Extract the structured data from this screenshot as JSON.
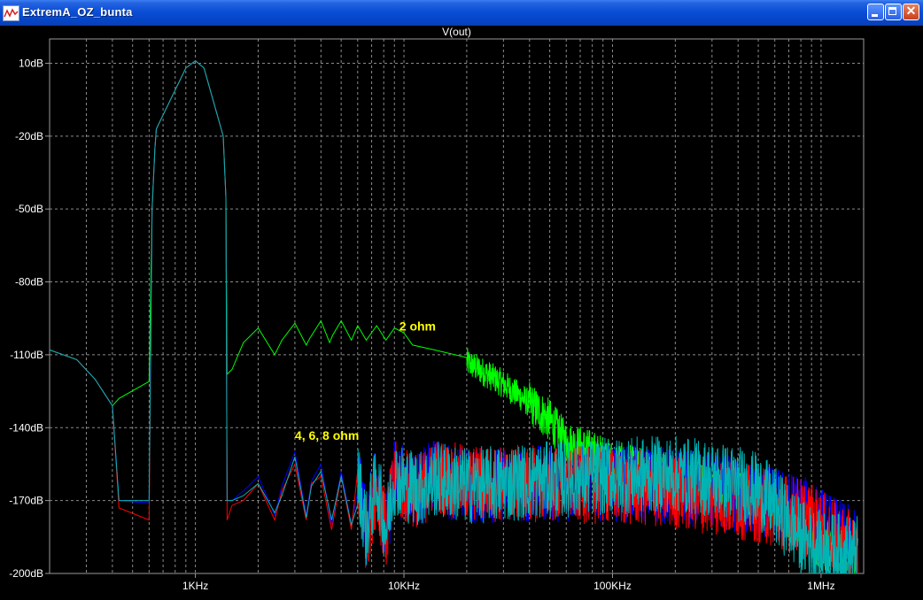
{
  "window": {
    "title": "ExtremA_OZ_bunta",
    "icon": "ltspice-waveform-icon",
    "buttons": [
      "minimize-icon",
      "maximize-icon",
      "close-icon"
    ]
  },
  "chart_data": {
    "type": "line",
    "title": "V(out)",
    "xscale": "log",
    "xlim": [
      200,
      1600000
    ],
    "ylim": [
      -200,
      20
    ],
    "grid": true,
    "x_ticks": [
      {
        "value": 1000,
        "label": "1KHz"
      },
      {
        "value": 10000,
        "label": "10KHz"
      },
      {
        "value": 100000,
        "label": "100KHz"
      },
      {
        "value": 1000000,
        "label": "1MHz"
      }
    ],
    "y_ticks": [
      {
        "value": 10,
        "label": "10dB"
      },
      {
        "value": -20,
        "label": "-20dB"
      },
      {
        "value": -50,
        "label": "-50dB"
      },
      {
        "value": -80,
        "label": "-80dB"
      },
      {
        "value": -110,
        "label": "-110dB"
      },
      {
        "value": -140,
        "label": "-140dB"
      },
      {
        "value": -170,
        "label": "-170dB"
      },
      {
        "value": -200,
        "label": "-200dB"
      }
    ],
    "annotations": [
      {
        "text": "2 ohm",
        "x": 9500,
        "y": -100,
        "color": "#ffff00"
      },
      {
        "text": "4, 6, 8 ohm",
        "x": 3000,
        "y": -145,
        "color": "#ffff00"
      }
    ],
    "series": [
      {
        "color": "#00ff00",
        "x": [
          200,
          270,
          330,
          400,
          430,
          600,
          620,
          640,
          650,
          900,
          1000,
          1100,
          1360,
          1400,
          1420,
          1500,
          1700,
          2000,
          2400,
          2600,
          3000,
          3400,
          3550,
          4000,
          4400,
          4550,
          5000,
          5600,
          6000,
          6600,
          7400,
          8200,
          9000,
          10000,
          11000,
          14000,
          20000,
          30000,
          40000,
          50000,
          60000,
          80000,
          100000,
          150000,
          200000,
          300000,
          400000,
          500000,
          600000,
          800000,
          1000000,
          1500000
        ],
        "y": [
          -108,
          -112,
          -120,
          -131,
          -128,
          -121,
          -50,
          -25,
          -17,
          8,
          11,
          8,
          -20,
          -45,
          -118,
          -116,
          -105,
          -99,
          -110,
          -104,
          -97,
          -106,
          -103,
          -96,
          -105,
          -102,
          -96,
          -104,
          -98,
          -104,
          -98,
          -104,
          -99,
          -101,
          -106,
          -108,
          -113,
          -122,
          -130,
          -137,
          -146,
          -150,
          -154,
          -158,
          -161,
          -164,
          -166,
          -167,
          -174,
          -180,
          -190,
          -194
        ],
        "noise_from": 20000
      },
      {
        "color": "#0000ff",
        "x": [
          200,
          270,
          330,
          400,
          430,
          600,
          620,
          640,
          650,
          900,
          1000,
          1100,
          1360,
          1400,
          1420,
          1500,
          1700,
          2000,
          2400,
          2600,
          3000,
          3400,
          3600,
          4000,
          4500,
          5000,
          5600,
          6000,
          6600,
          7400,
          8200,
          9000,
          10000,
          12000,
          14000,
          20000,
          40000,
          100000,
          200000,
          400000,
          800000,
          1500000
        ],
        "y": [
          -108,
          -112,
          -120,
          -131,
          -170,
          -171,
          -50,
          -25,
          -17,
          8,
          11,
          8,
          -20,
          -45,
          -170,
          -170,
          -166,
          -160,
          -176,
          -164,
          -150,
          -176,
          -162,
          -155,
          -180,
          -158,
          -180,
          -160,
          -182,
          -162,
          -182,
          -160,
          -163,
          -165,
          -160,
          -164,
          -163,
          -163,
          -164,
          -168,
          -175,
          -190
        ],
        "noise_from": 6000
      },
      {
        "color": "#ff0000",
        "x": [
          200,
          270,
          330,
          400,
          430,
          600,
          620,
          640,
          650,
          900,
          1000,
          1100,
          1360,
          1400,
          1420,
          1500,
          1700,
          2000,
          2400,
          2600,
          3000,
          3400,
          3600,
          4000,
          4500,
          5000,
          5600,
          6000,
          6600,
          7400,
          8200,
          9000,
          10000,
          12000,
          14000,
          20000,
          40000,
          100000,
          200000,
          400000,
          800000,
          1500000
        ],
        "y": [
          -108,
          -112,
          -120,
          -131,
          -173,
          -178,
          -50,
          -25,
          -17,
          8,
          11,
          8,
          -20,
          -45,
          -178,
          -172,
          -170,
          -163,
          -178,
          -166,
          -155,
          -178,
          -163,
          -160,
          -182,
          -160,
          -182,
          -162,
          -184,
          -163,
          -184,
          -161,
          -164,
          -166,
          -160,
          -163,
          -163,
          -164,
          -166,
          -170,
          -176,
          -192
        ],
        "noise_from": 6000
      },
      {
        "color": "#00b4b4",
        "x": [
          200,
          270,
          330,
          400,
          430,
          600,
          620,
          640,
          650,
          900,
          1000,
          1100,
          1360,
          1400,
          1420,
          1500,
          1700,
          2000,
          2400,
          2600,
          3000,
          3400,
          3600,
          4000,
          4500,
          5000,
          5600,
          6000,
          6600,
          7400,
          8200,
          9000,
          10000,
          12000,
          14000,
          20000,
          40000,
          100000,
          200000,
          300000,
          400000,
          500000,
          600000,
          800000,
          1000000,
          1500000
        ],
        "y": [
          -108,
          -112,
          -120,
          -131,
          -170,
          -170,
          -50,
          -25,
          -17,
          8,
          11,
          8,
          -20,
          -45,
          -170,
          -170,
          -168,
          -163,
          -175,
          -168,
          -152,
          -177,
          -164,
          -158,
          -178,
          -160,
          -180,
          -160,
          -182,
          -162,
          -182,
          -160,
          -163,
          -165,
          -161,
          -164,
          -162,
          -160,
          -159,
          -161,
          -163,
          -166,
          -172,
          -185,
          -190,
          -192
        ],
        "noise_from": 6000
      }
    ]
  }
}
